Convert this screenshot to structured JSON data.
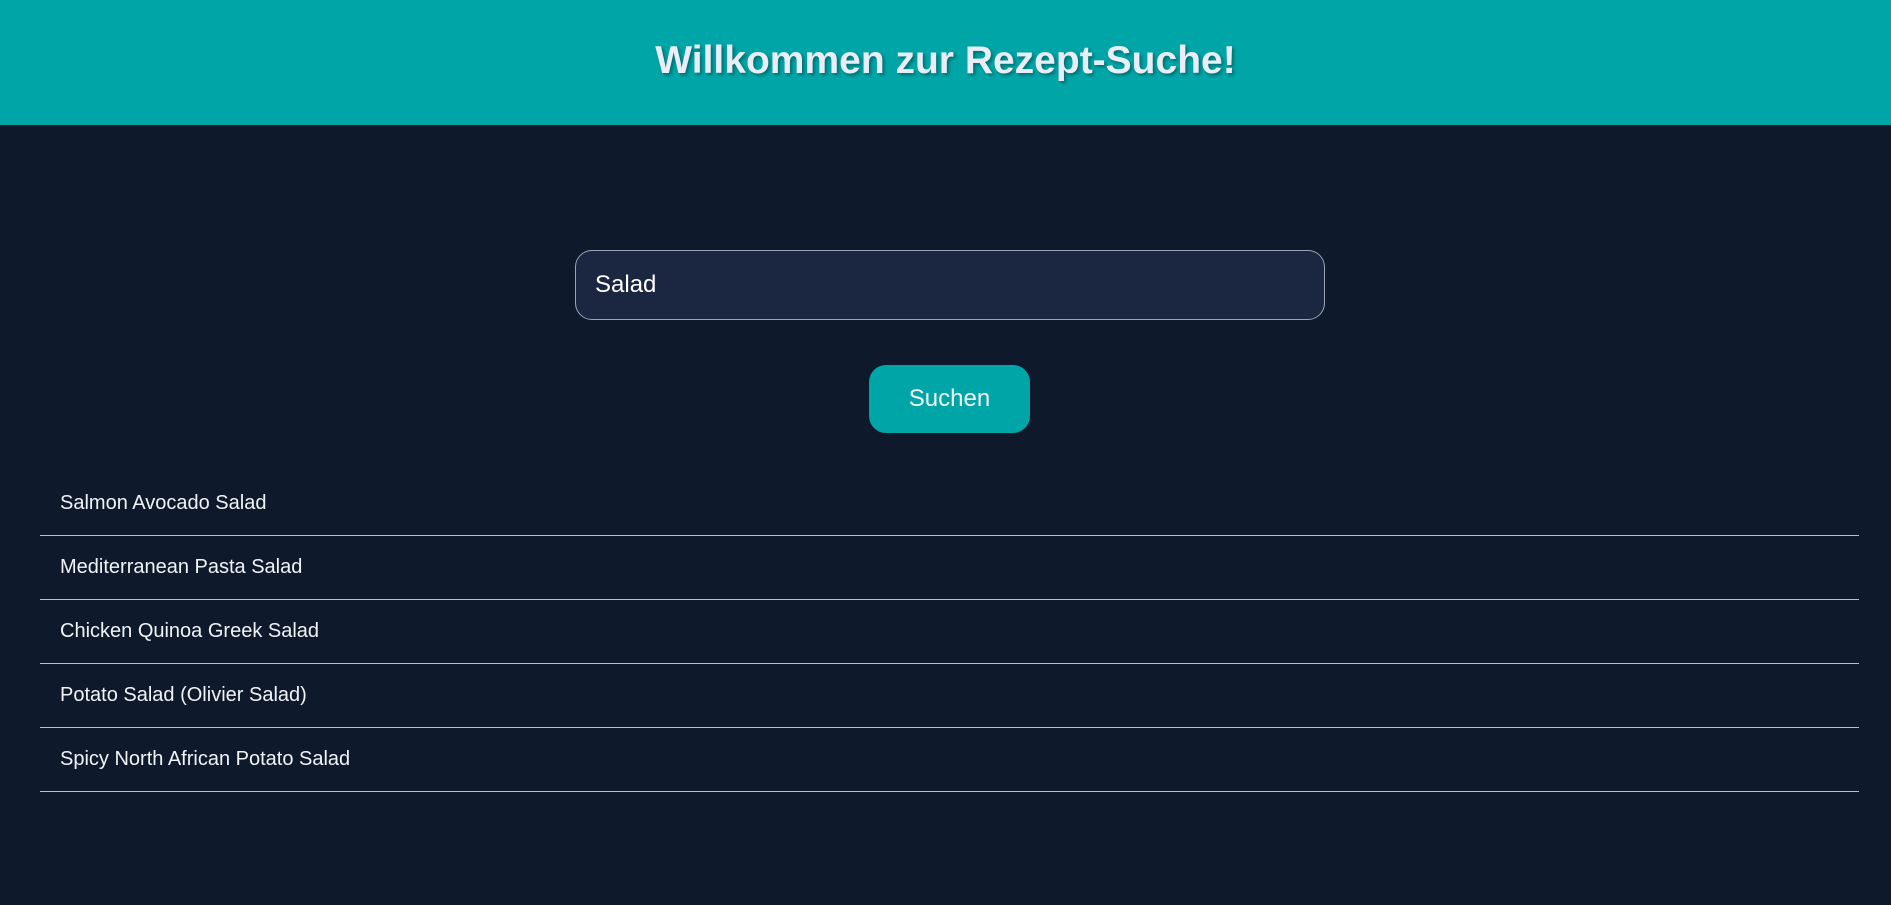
{
  "header": {
    "title": "Willkommen zur Rezept-Suche!"
  },
  "search": {
    "value": "Salad",
    "button_label": "Suchen"
  },
  "results": [
    "Salmon Avocado Salad",
    "Mediterranean Pasta Salad",
    "Chicken Quinoa Greek Salad",
    "Potato Salad (Olivier Salad)",
    "Spicy North African Potato Salad"
  ],
  "colors": {
    "accent": "#00a5a7",
    "background": "#0e1a2b",
    "input_background": "#1b2640",
    "divider": "#b8c0cc"
  }
}
